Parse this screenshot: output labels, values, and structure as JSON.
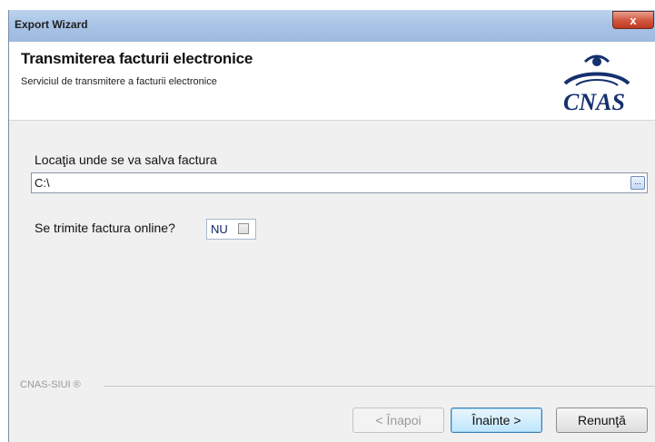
{
  "window": {
    "title": "Export Wizard",
    "close_label": "x"
  },
  "header": {
    "title": "Transmiterea facturii electronice",
    "subtitle": "Serviciul de transmitere a facturii electronice",
    "logo_text": "CNAS"
  },
  "location": {
    "label": "Locaţia unde se va salva factura",
    "value": "C:\\",
    "browse_label": "..."
  },
  "online": {
    "label": "Se trimite factura online?",
    "value": "NU",
    "checked": false
  },
  "footer": {
    "brand": "CNAS-SIUI ®"
  },
  "buttons": {
    "back": "< Înapoi",
    "next": "Înainte >",
    "cancel": "Renunţă"
  },
  "colors": {
    "title_bar": "#a9c4e6",
    "close_button": "#c0381f",
    "logo": "#15306e",
    "default_button": "#bee6fd"
  }
}
